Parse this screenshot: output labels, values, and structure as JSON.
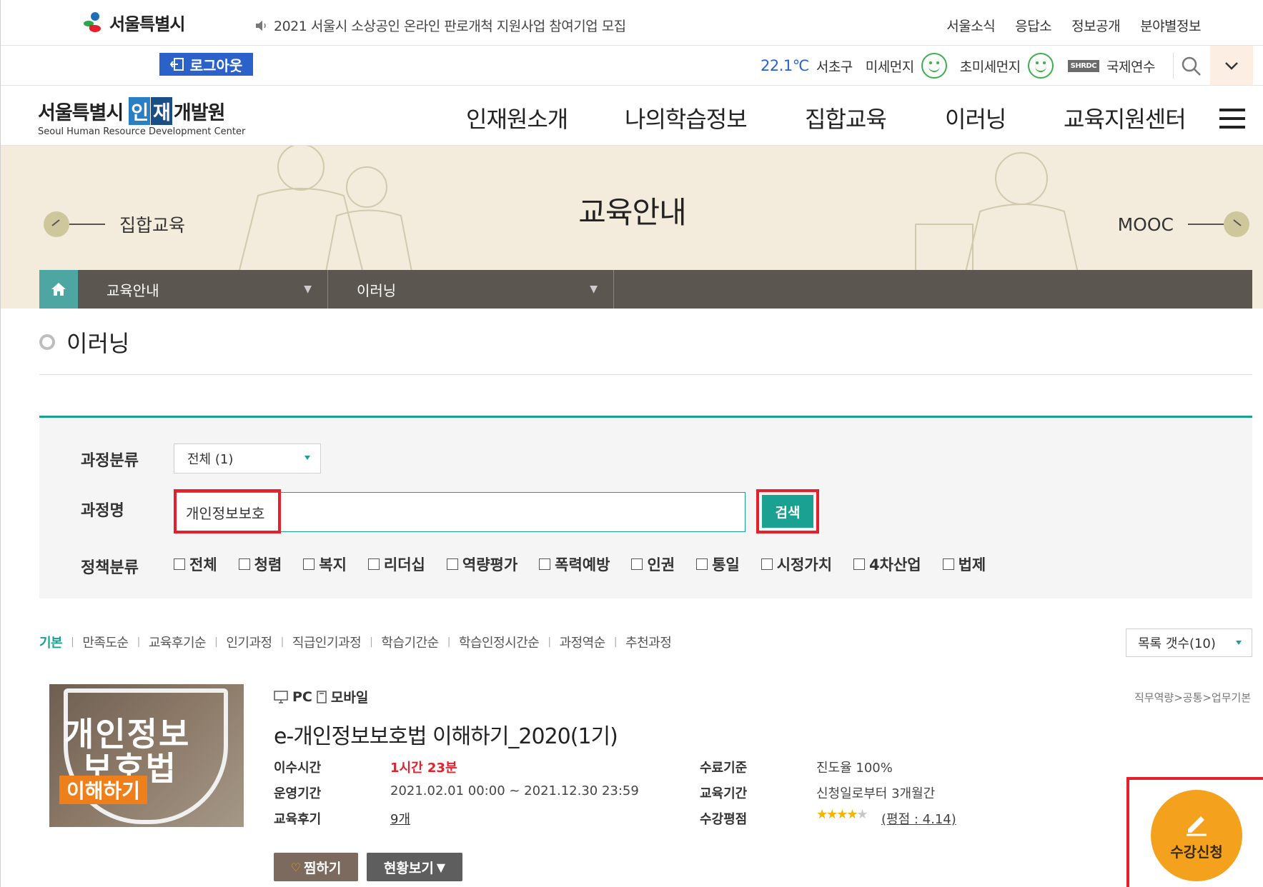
{
  "topbar": {
    "logo_text": "서울특별시",
    "notice": "2021 서울시 소상공인 온라인 판로개척 지원사업 참여기업 모집",
    "links": [
      "서울소식",
      "응답소",
      "정보공개",
      "분야별정보"
    ]
  },
  "bar2": {
    "logout": "로그아웃",
    "temperature": "22.1℃",
    "district": "서초구",
    "dust_label": "미세먼지",
    "fine_dust_label": "초미세먼지",
    "sbdc_badge": "SHRDC",
    "intl_training": "국제연수"
  },
  "org": {
    "title_a": "서울특별시",
    "title_b": "인",
    "title_c": "재",
    "title_d": "개발원",
    "subtitle": "Seoul Human Resource Development Center"
  },
  "nav": [
    "인재원소개",
    "나의학습정보",
    "집합교육",
    "이러닝",
    "교육지원센터"
  ],
  "banner": {
    "title": "교육안내",
    "prev": "집합교육",
    "next": "MOOC"
  },
  "breadcrumb": {
    "level1": "교육안내",
    "level2": "이러닝"
  },
  "page_title": "이러닝",
  "search": {
    "category_label": "과정분류",
    "category_value": "전체 (1)",
    "name_label": "과정명",
    "name_value": "개인정보보호",
    "search_button": "검색",
    "policy_label": "정책분류",
    "policy_options": [
      "전체",
      "청렴",
      "복지",
      "리더십",
      "역량평가",
      "폭력예방",
      "인권",
      "통일",
      "시정가치",
      "4차산업",
      "법제"
    ]
  },
  "sort": {
    "options": [
      "기본",
      "만족도순",
      "교육후기순",
      "인기과정",
      "직급인기과정",
      "학습기간순",
      "학습인정시간순",
      "과정역순",
      "추천과정"
    ],
    "count_select": "목록 갯수(10)"
  },
  "course": {
    "thumb_line1": "개인정보",
    "thumb_line2": "보호법",
    "thumb_line3": "이해하기",
    "device_pc": "PC",
    "device_mobile": "모바일",
    "category_path": "직무역량>공통>업무기본",
    "title": "e-개인정보보호법 이해하기_2020(1기)",
    "completion_time_label": "이수시간",
    "completion_time": "1시간 23분",
    "period_label": "운영기간",
    "period": "2021.02.01 00:00 ~ 2021.12.30 23:59",
    "reviews_label": "교육후기",
    "reviews": "9개",
    "criteria_label": "수료기준",
    "criteria": "진도율 100%",
    "edu_period_label": "교육기간",
    "edu_period": "신청일로부터 3개월간",
    "rating_label": "수강평점",
    "rating_stars": 4,
    "rating_text": "(평점 : 4.14)",
    "like_button": "찜하기",
    "status_button": "현황보기",
    "enroll_button": "수강신청"
  },
  "colors": {
    "accent_teal": "#1aa192",
    "highlight_red": "#e3202b",
    "logout_blue": "#2a62c9",
    "enroll_orange": "#f4a11e"
  }
}
